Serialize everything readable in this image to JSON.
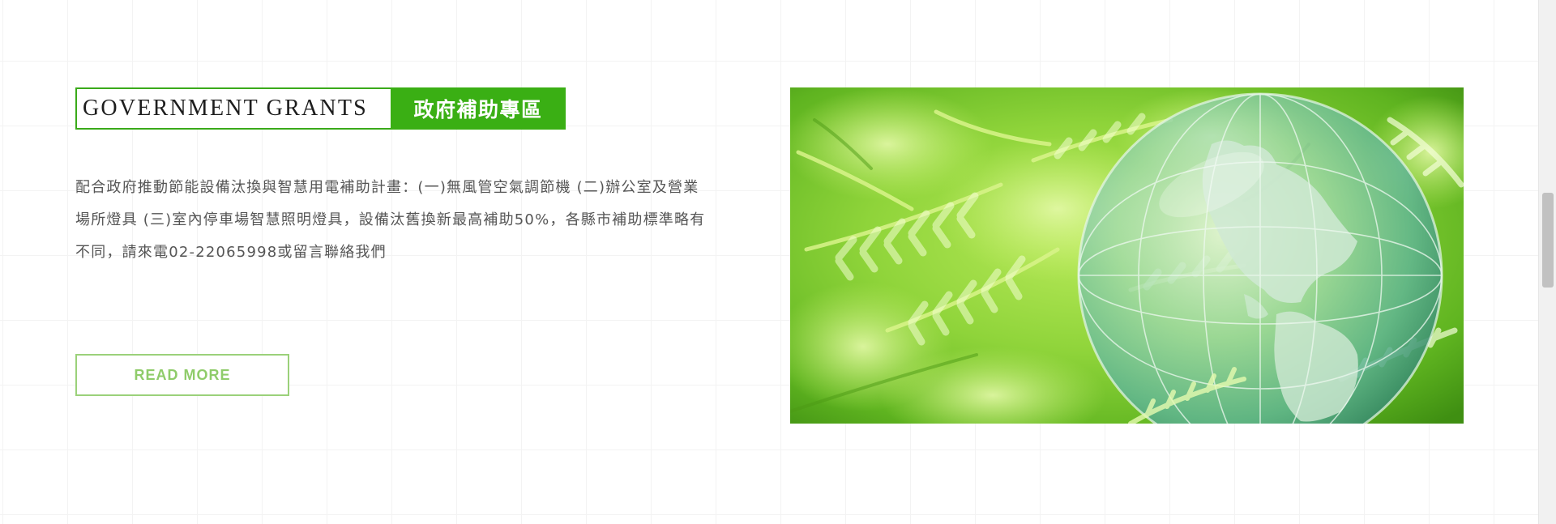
{
  "section": {
    "title_en": "GOVERNMENT GRANTS",
    "title_zh": "政府補助專區",
    "description_lines": [
      "配合政府推動節能設備汰換與智慧用電補助計畫：(一)無風管空氣調節機 (二)辦公室及營業",
      "場所燈具 (三)室內停車場智慧照明燈具，設備汰舊換新最高補助50%，各縣市補助標準略有",
      "不同，請來電02-22065998或留言聯絡我們"
    ],
    "read_more_label": "READ MORE",
    "image": {
      "subject": "glass-globe-on-ferns",
      "alt": ""
    }
  },
  "colors": {
    "accent_green": "#3aaf14",
    "button_green": "#8fcc6a",
    "text_gray": "#555555",
    "title_text": "#1d1d1d"
  },
  "icons": {
    "scrollbar": "vertical-scrollbar"
  }
}
